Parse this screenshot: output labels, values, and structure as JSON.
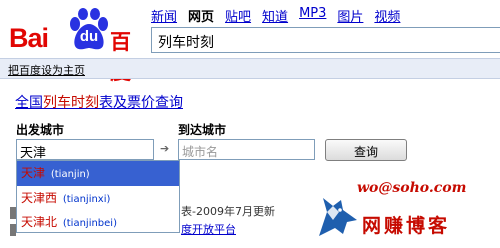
{
  "logo": {
    "part1": "Bai",
    "part2": "du",
    "part3": "百度"
  },
  "nav": [
    {
      "label": "新闻",
      "active": false
    },
    {
      "label": "网页",
      "active": true
    },
    {
      "label": "贴吧",
      "active": false
    },
    {
      "label": "知道",
      "active": false
    },
    {
      "label": "MP3",
      "active": false
    },
    {
      "label": "图片",
      "active": false
    },
    {
      "label": "视频",
      "active": false
    }
  ],
  "search": {
    "value": "列车时刻"
  },
  "subbar": {
    "set_home": "把百度设为主页"
  },
  "title": {
    "prefix": "全国",
    "highlight": "列车时刻",
    "suffix": "表及票价查询"
  },
  "form": {
    "from_label": "出发城市",
    "from_value": "天津",
    "arrow": "➔",
    "to_label": "到达城市",
    "to_placeholder": "城市名",
    "query_button": "查询"
  },
  "suggestions": [
    {
      "cn": "天津",
      "py": "(tianjin)"
    },
    {
      "cn": "天津西",
      "py": "(tianjinxi)"
    },
    {
      "cn": "天津北",
      "py": "(tianjinbei)"
    }
  ],
  "footer": {
    "update_text": "表-2009年7月更新",
    "open_platform": "度开放平台"
  },
  "watermark": {
    "email": "wo@soho.com",
    "name": "网赚博客"
  },
  "colors": {
    "brand_red": "#e10602",
    "link_blue": "#0000cc",
    "selected_bg": "#3761d1"
  }
}
